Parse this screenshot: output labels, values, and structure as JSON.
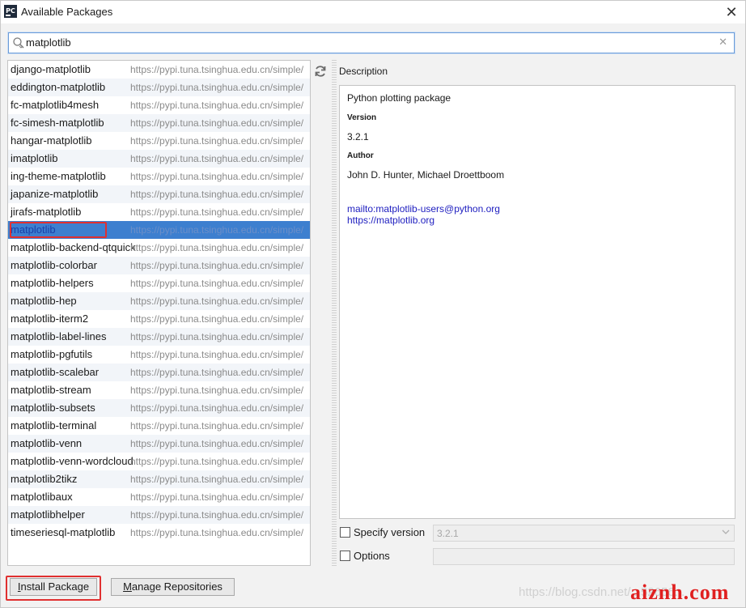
{
  "window": {
    "title": "Available Packages",
    "app_icon": "PC"
  },
  "search": {
    "value": "matplotlib"
  },
  "packages": [
    {
      "name": "django-matplotlib",
      "url": "https://pypi.tuna.tsinghua.edu.cn/simple/"
    },
    {
      "name": "eddington-matplotlib",
      "url": "https://pypi.tuna.tsinghua.edu.cn/simple/"
    },
    {
      "name": "fc-matplotlib4mesh",
      "url": "https://pypi.tuna.tsinghua.edu.cn/simple/"
    },
    {
      "name": "fc-simesh-matplotlib",
      "url": "https://pypi.tuna.tsinghua.edu.cn/simple/"
    },
    {
      "name": "hangar-matplotlib",
      "url": "https://pypi.tuna.tsinghua.edu.cn/simple/"
    },
    {
      "name": "imatplotlib",
      "url": "https://pypi.tuna.tsinghua.edu.cn/simple/"
    },
    {
      "name": "ing-theme-matplotlib",
      "url": "https://pypi.tuna.tsinghua.edu.cn/simple/"
    },
    {
      "name": "japanize-matplotlib",
      "url": "https://pypi.tuna.tsinghua.edu.cn/simple/"
    },
    {
      "name": "jirafs-matplotlib",
      "url": "https://pypi.tuna.tsinghua.edu.cn/simple/"
    },
    {
      "name": "matplotlib",
      "url": "https://pypi.tuna.tsinghua.edu.cn/simple/"
    },
    {
      "name": "matplotlib-backend-qtquick",
      "url": "https://pypi.tuna.tsinghua.edu.cn/simple/"
    },
    {
      "name": "matplotlib-colorbar",
      "url": "https://pypi.tuna.tsinghua.edu.cn/simple/"
    },
    {
      "name": "matplotlib-helpers",
      "url": "https://pypi.tuna.tsinghua.edu.cn/simple/"
    },
    {
      "name": "matplotlib-hep",
      "url": "https://pypi.tuna.tsinghua.edu.cn/simple/"
    },
    {
      "name": "matplotlib-iterm2",
      "url": "https://pypi.tuna.tsinghua.edu.cn/simple/"
    },
    {
      "name": "matplotlib-label-lines",
      "url": "https://pypi.tuna.tsinghua.edu.cn/simple/"
    },
    {
      "name": "matplotlib-pgfutils",
      "url": "https://pypi.tuna.tsinghua.edu.cn/simple/"
    },
    {
      "name": "matplotlib-scalebar",
      "url": "https://pypi.tuna.tsinghua.edu.cn/simple/"
    },
    {
      "name": "matplotlib-stream",
      "url": "https://pypi.tuna.tsinghua.edu.cn/simple/"
    },
    {
      "name": "matplotlib-subsets",
      "url": "https://pypi.tuna.tsinghua.edu.cn/simple/"
    },
    {
      "name": "matplotlib-terminal",
      "url": "https://pypi.tuna.tsinghua.edu.cn/simple/"
    },
    {
      "name": "matplotlib-venn",
      "url": "https://pypi.tuna.tsinghua.edu.cn/simple/"
    },
    {
      "name": "matplotlib-venn-wordcloud",
      "url": "https://pypi.tuna.tsinghua.edu.cn/simple/"
    },
    {
      "name": "matplotlib2tikz",
      "url": "https://pypi.tuna.tsinghua.edu.cn/simple/"
    },
    {
      "name": "matplotlibaux",
      "url": "https://pypi.tuna.tsinghua.edu.cn/simple/"
    },
    {
      "name": "matplotlibhelper",
      "url": "https://pypi.tuna.tsinghua.edu.cn/simple/"
    },
    {
      "name": "timeseriesql-matplotlib",
      "url": "https://pypi.tuna.tsinghua.edu.cn/simple/"
    }
  ],
  "selected_package": "matplotlib",
  "description": {
    "label": "Description",
    "summary": "Python plotting package",
    "version_heading": "Version",
    "version_value": "3.2.1",
    "author_heading": "Author",
    "author_value": "John D. Hunter, Michael Droettboom",
    "links": [
      "mailto:matplotlib-users@python.org",
      "https://matplotlib.org"
    ]
  },
  "options": {
    "specify_version_label": "Specify version",
    "specify_version_checked": false,
    "version_selected": "3.2.1",
    "options_label": "Options",
    "options_checked": false,
    "options_value": ""
  },
  "buttons": {
    "install_pre": "",
    "install_mnemonic": "I",
    "install_post": "nstall Package",
    "manage_pre": "",
    "manage_mnemonic": "M",
    "manage_post": "anage Repositories"
  },
  "watermark": {
    "url": "https://blog.csdn.net/...52656...",
    "logo": "aiznh.com"
  },
  "colors": {
    "selection": "#3d7fcf",
    "link": "#2020c0",
    "annotation": "#e03030",
    "focus_border": "#6a9bd8"
  }
}
